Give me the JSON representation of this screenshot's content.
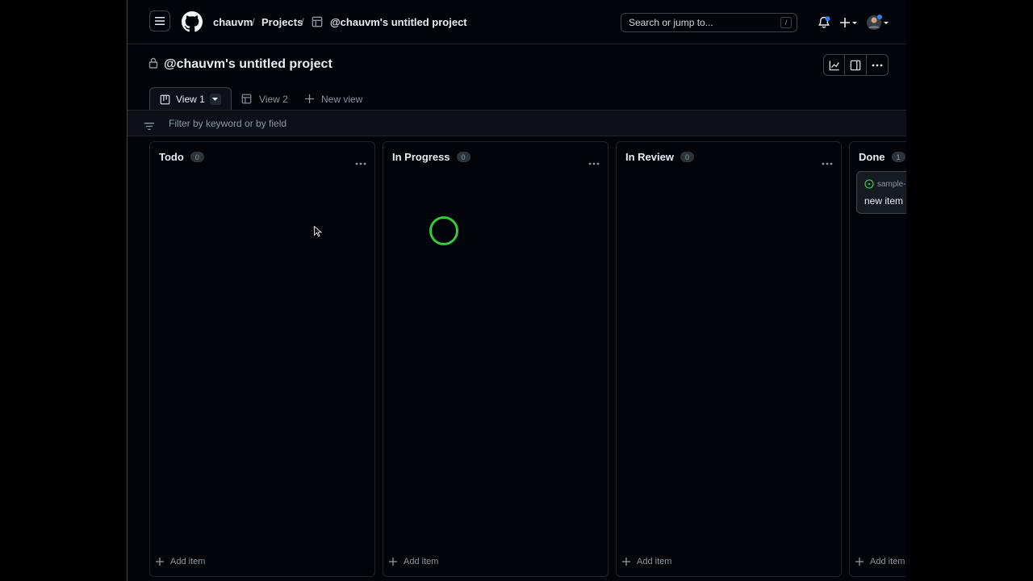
{
  "header": {
    "owner": "chauvm",
    "projects_label": "Projects",
    "project_name": "@chauvm's untitled project",
    "separator": "/",
    "search_placeholder": "Search or jump to...",
    "search_shortcut": "/"
  },
  "page": {
    "title": "@chauvm's untitled project"
  },
  "tabs": [
    {
      "label": "View 1",
      "active": true
    },
    {
      "label": "View 2",
      "active": false
    },
    {
      "label": "New view",
      "active": false
    }
  ],
  "filter": {
    "placeholder": "Filter by keyword or by field"
  },
  "columns": [
    {
      "name": "Todo",
      "count": "0",
      "add_label": "Add item"
    },
    {
      "name": "In Progress",
      "count": "0",
      "add_label": "Add item"
    },
    {
      "name": "In Review",
      "count": "0",
      "add_label": "Add item"
    },
    {
      "name": "Done",
      "count": "1",
      "add_label": "Add item",
      "cards": [
        {
          "repo": "sample-",
          "title": "new item"
        }
      ]
    }
  ],
  "icons": {
    "menu": "hamburger-icon",
    "logo": "github-logo-icon",
    "project": "table-icon",
    "notifications": "bell-icon",
    "create": "plus-icon",
    "avatar": "avatar",
    "insights": "graph-icon",
    "layout": "sidebar-icon",
    "more": "kebab-icon",
    "lock": "lock-icon",
    "filter": "filter-icon",
    "board": "board-icon",
    "open_issue": "issue-opened-icon"
  },
  "colors": {
    "background": "#010409",
    "accent_blue": "#2f81f7",
    "open_green": "#3fb950",
    "cursor_green": "#36c93b"
  }
}
